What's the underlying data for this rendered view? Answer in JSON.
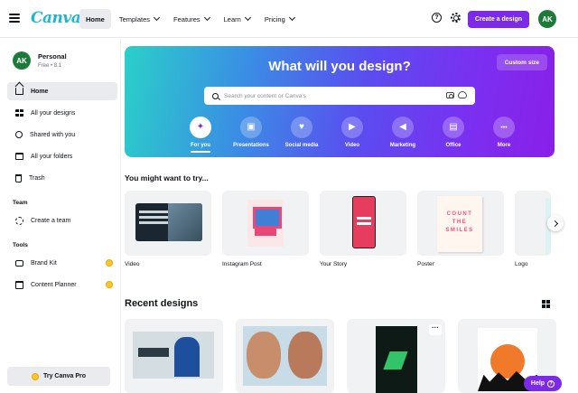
{
  "header": {
    "logo": "Canva",
    "nav": [
      {
        "label": "Home",
        "dropdown": false,
        "active": true
      },
      {
        "label": "Templates",
        "dropdown": true
      },
      {
        "label": "Features",
        "dropdown": true
      },
      {
        "label": "Learn",
        "dropdown": true
      },
      {
        "label": "Pricing",
        "dropdown": true
      }
    ],
    "help_glyph": "?",
    "create_button": "Create a design",
    "avatar_initials": "AK"
  },
  "sidebar": {
    "user": {
      "initials": "AK",
      "name": "Personal",
      "plan": "Free • 8.1"
    },
    "items": [
      {
        "label": "Home",
        "icon": "home-icon",
        "active": true
      },
      {
        "label": "All your designs",
        "icon": "grid-icon"
      },
      {
        "label": "Shared with you",
        "icon": "people-icon"
      },
      {
        "label": "All your folders",
        "icon": "folder-icon"
      },
      {
        "label": "Trash",
        "icon": "trash-icon"
      }
    ],
    "team_section": {
      "title": "Team",
      "items": [
        {
          "label": "Create a team",
          "icon": "team-icon"
        }
      ]
    },
    "tools_section": {
      "title": "Tools",
      "items": [
        {
          "label": "Brand Kit",
          "icon": "brand-kit-icon",
          "pro": true
        },
        {
          "label": "Content Planner",
          "icon": "calendar-icon",
          "pro": true
        }
      ]
    },
    "pro_button": "Try Canva Pro"
  },
  "hero": {
    "title": "What will you design?",
    "custom_size": "Custom size",
    "search_placeholder": "Search your content or Canva's",
    "categories": [
      {
        "label": "For you",
        "icon": "sparkle-icon",
        "glyph": "✦",
        "active": true
      },
      {
        "label": "Presentations",
        "icon": "presentation-icon",
        "glyph": "▣"
      },
      {
        "label": "Social media",
        "icon": "heart-icon",
        "glyph": "♥"
      },
      {
        "label": "Video",
        "icon": "video-icon",
        "glyph": "▶"
      },
      {
        "label": "Marketing",
        "icon": "megaphone-icon",
        "glyph": "◀"
      },
      {
        "label": "Office",
        "icon": "briefcase-icon",
        "glyph": "▤"
      },
      {
        "label": "More",
        "icon": "more-icon",
        "glyph": "•••"
      }
    ]
  },
  "suggestions": {
    "title": "You might want to try...",
    "items": [
      {
        "label": "Video",
        "thumb": "video"
      },
      {
        "label": "Instagram Post",
        "thumb": "insta"
      },
      {
        "label": "Your Story",
        "thumb": "story"
      },
      {
        "label": "Poster",
        "thumb": "poster"
      },
      {
        "label": "Logo",
        "thumb": "logo"
      }
    ]
  },
  "recent": {
    "title": "Recent designs",
    "cards": 4
  },
  "help_button": "Help"
}
